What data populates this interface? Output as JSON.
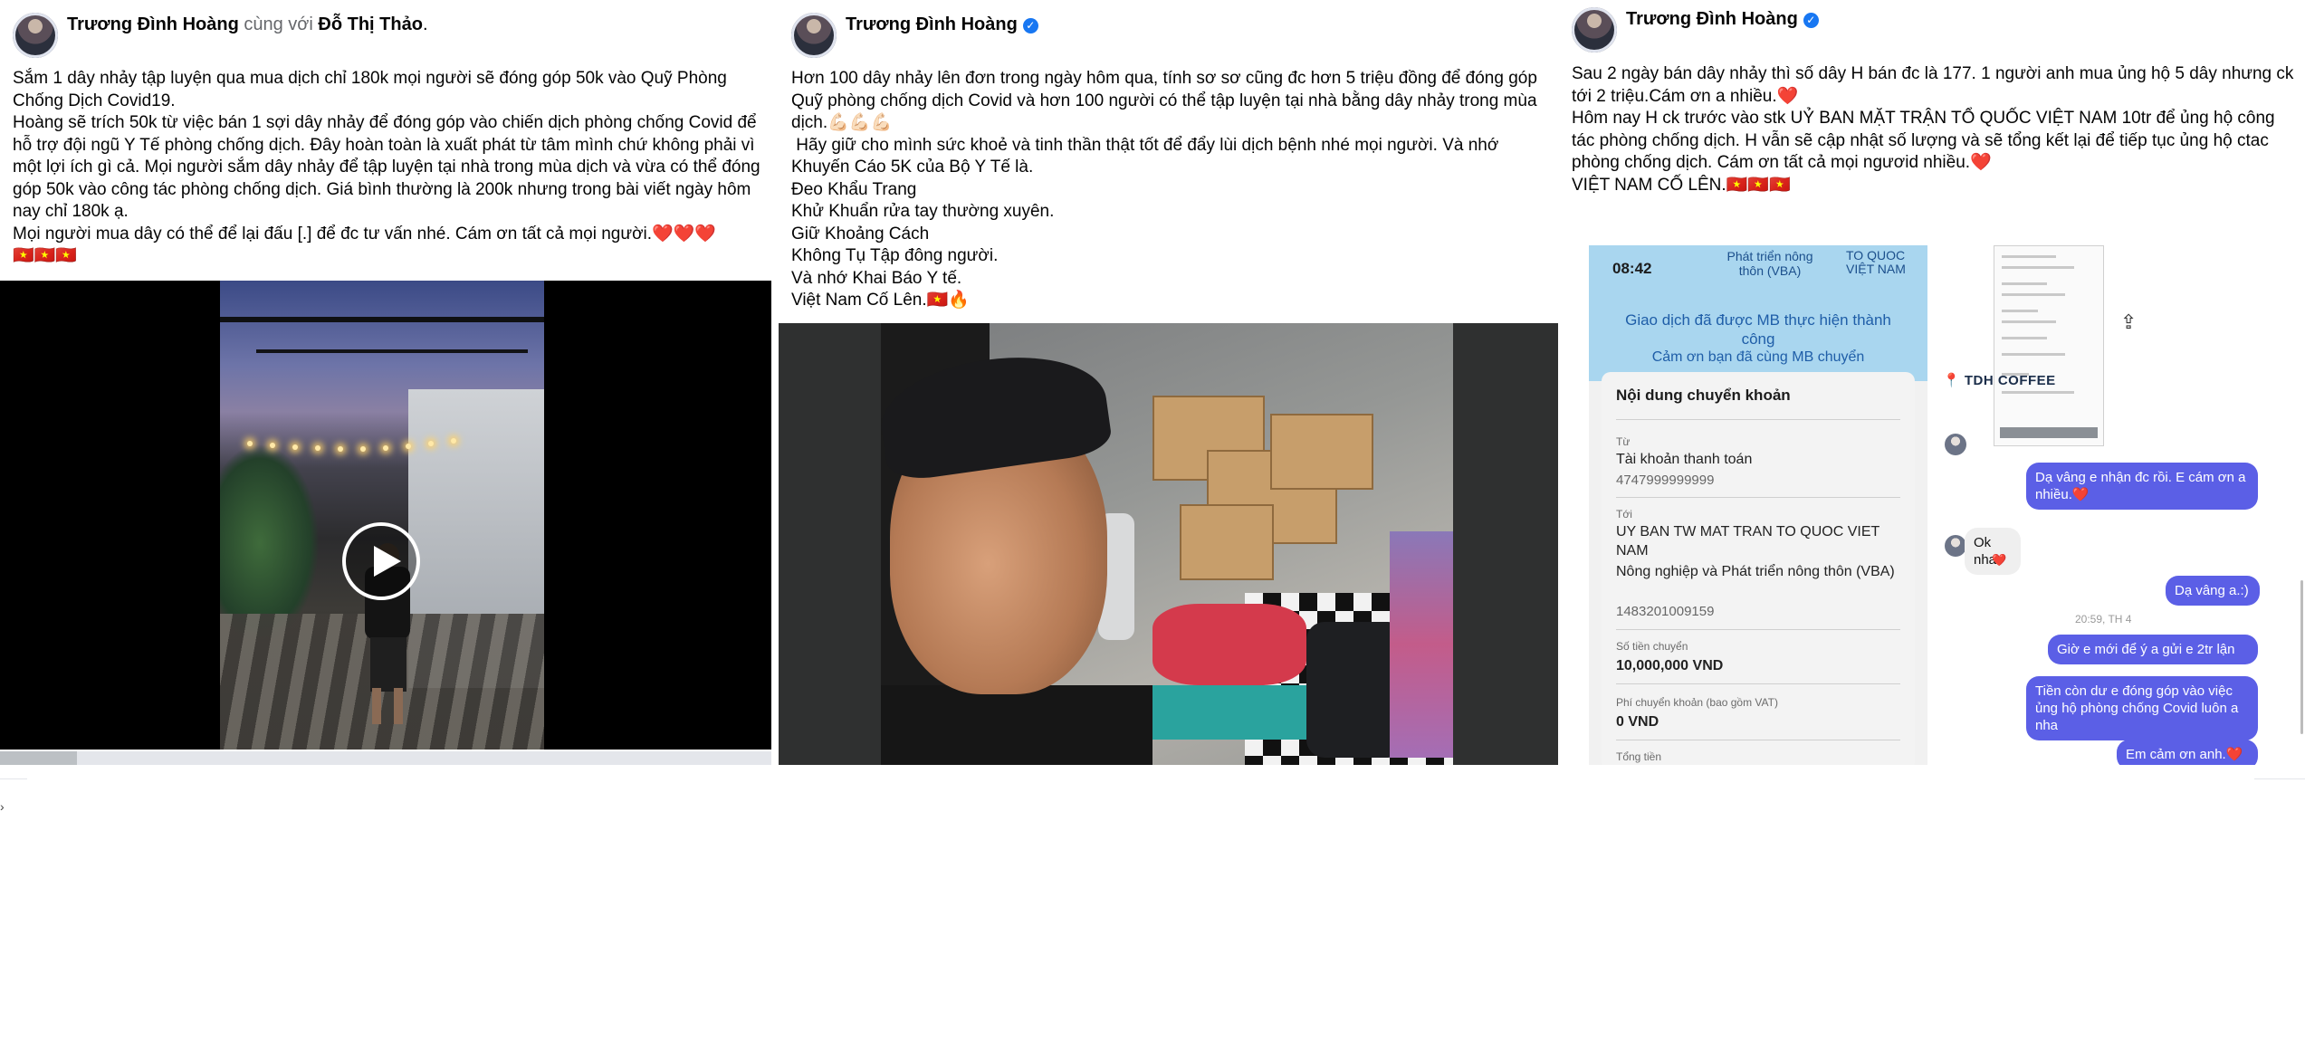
{
  "post1": {
    "author": "Trương Đình Hoàng",
    "with_text": "cùng với",
    "tagged": "Đỗ Thị Thảo",
    "tagged_suffix": ".",
    "body": "Sắm 1 dây nhảy tập luyện qua mua dịch chỉ 180k mọi người sẽ đóng góp 50k vào Quỹ Phòng Chống Dịch Covid19.\nHoàng sẽ trích 50k từ việc bán 1 sợi dây nhảy để đóng góp vào chiến dịch phòng chống Covid để hỗ trợ đội ngũ Y Tế phòng chống dịch. Đây hoàn toàn là xuất phát từ tâm mình chứ không phải vì một lợi ích gì cả. Mọi người sắm dây nhảy để tập luyện tại nhà trong mùa dịch và vừa có thể đóng góp 50k vào công tác phòng chống dịch. Giá bình thường là 200k nhưng trong bài viết ngày hôm nay chỉ 180k ạ.\nMọi người mua dây có thể để lại đấu [.] để đc tư vấn nhé. Cám ơn tất cả mọi người.❤️❤️❤️\n🇻🇳🇻🇳🇻🇳",
    "video_progress": 0.1
  },
  "post2": {
    "author": "Trương Đình Hoàng",
    "body": "Hơn 100 dây nhảy lên đơn trong ngày hôm qua, tính sơ sơ cũng đc hơn 5 triệu đồng để đóng góp Quỹ phòng chống dịch Covid và hơn 100 người có thể tập luyện tại nhà bằng dây nhảy trong mùa dịch.💪🏻💪🏻💪🏻\n Hãy giữ cho mình sức khoẻ và tinh thần thật tốt để đẩy lùi dịch bệnh nhé mọi người. Và nhớ Khuyến Cáo 5K của Bộ Y Tế là.\nĐeo Khẩu Trang\nKhử Khuẩn rửa tay thường xuyên.\nGiữ Khoảng Cách\nKhông Tụ Tập đông người.\nVà nhớ Khai Báo Y tế.\nViệt Nam Cố Lên.🇻🇳🔥"
  },
  "post3": {
    "author": "Trương Đình Hoàng",
    "body": "Sau 2 ngày bán dây nhảy thì số dây H bán đc là 177. 1 người anh mua ủng hộ 5 dây nhưng ck tới 2 triệu.Cám ơn a nhiều.❤️\nHôm nay H ck trước vào stk UỶ BAN MẶT TRẬN TỔ QUỐC VIỆT NAM 10tr để ủng hộ công tác phòng chống dịch. H vẫn sẽ cập nhật số lượng và sẽ tổng kết lại để tiếp tục ủng hộ ctac phòng chống dịch. Cám ơn tất cả mọi ngươid nhiều.❤️\nVIỆT NAM CỐ LÊN.🇻🇳🇻🇳🇻🇳",
    "bank": {
      "time": "08:42",
      "top_center": "Phát triển nông thôn (VBA)",
      "top_right": "TO QUOC VIỆT NAM",
      "success": "Giao dịch đã được MB thực hiện thành công",
      "thanks": "Cảm ơn bạn đã cùng MB chuyển",
      "card_title": "Nội dung chuyển khoản",
      "from_label": "Từ",
      "from_value": "Tài khoản thanh toán",
      "from_account": "4747999999999",
      "to_label": "Tới",
      "to_value": "UY BAN TW MAT TRAN TO QUOC VIET NAM",
      "to_bank": "Nông nghiệp và Phát triển nông thôn (VBA)",
      "to_account": "1483201009159",
      "amount_label": "Số tiền chuyển",
      "amount_value": "10,000,000 VND",
      "fee_label": "Phí chuyển khoản (bao gồm VAT)",
      "fee_value": "0 VND",
      "next_label": "Tổng tiền"
    },
    "chat": {
      "coffee": "TDH COFFEE",
      "messages": [
        {
          "dir": "out",
          "text": "Dạ vâng e nhận đc rồi. E cám ơn a nhiều.❤️"
        },
        {
          "dir": "in",
          "text": "Ok nha"
        },
        {
          "dir": "out",
          "text": "Dạ vâng a.:)"
        },
        {
          "dir": "out",
          "text": "Giờ e mới để ý a gửi e 2tr lận"
        },
        {
          "dir": "out",
          "text": "Tiền còn dư e đóng góp vào việc ủng hộ phòng chống Covid luôn a nha"
        },
        {
          "dir": "out",
          "text": "Em cảm ơn anh.❤️"
        }
      ],
      "time": "20:59, TH 4",
      "react": "❤️"
    }
  },
  "colors": {
    "verified": "#1877f2",
    "chat_bubble": "#5b5fe6",
    "bank_header": "#a9d6ef"
  }
}
